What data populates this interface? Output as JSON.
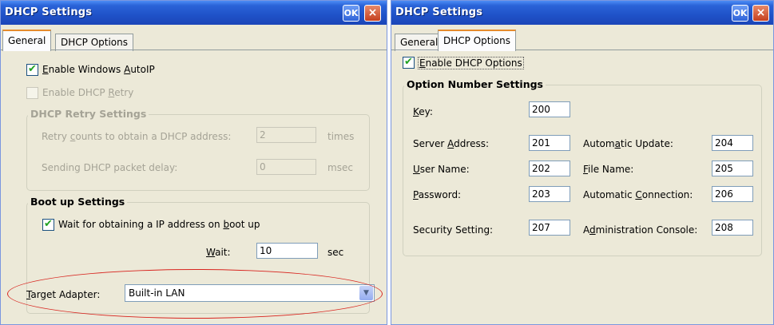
{
  "left_window": {
    "title": "DHCP Settings",
    "ok_label": "OK",
    "close_label": "×",
    "tabs": [
      {
        "label": "General",
        "active": true
      },
      {
        "label": "DHCP Options",
        "active": false
      }
    ],
    "enable_autoip": {
      "prefix": "",
      "accel": "E",
      "rest": "nable Windows ",
      "accel2": "A",
      "rest2": "utoIP",
      "checked": true
    },
    "enable_dhcp_retry": {
      "label_a": "Enable DHCP ",
      "accel": "R",
      "label_b": "etry",
      "checked": false
    },
    "retry_group": {
      "title": "DHCP Retry Settings",
      "retry_counts": {
        "label_a": "Retry ",
        "accel": "c",
        "label_b": "ounts to obtain a DHCP address:",
        "value": "2",
        "unit": "times"
      },
      "packet_delay": {
        "label_a": "Sending DHCP packet delay:",
        "value": "0",
        "unit": "msec"
      }
    },
    "boot_group": {
      "title": "Boot up Settings",
      "wait_ip": {
        "label_a": "Wait for obtaining a IP address on ",
        "accel": "b",
        "label_b": "oot up",
        "checked": true
      },
      "wait": {
        "accel": "W",
        "label_b": "ait:",
        "value": "10",
        "unit": "sec"
      }
    },
    "target_adapter": {
      "accel": "T",
      "label_b": "arget Adapter:",
      "selected": "Built-in LAN"
    }
  },
  "right_window": {
    "title": "DHCP Settings",
    "ok_label": "OK",
    "close_label": "×",
    "tabs": [
      {
        "label": "General",
        "active": false
      },
      {
        "label": "DHCP Options",
        "active": true
      }
    ],
    "enable_options": {
      "accel": "E",
      "label_b": "nable DHCP Options",
      "checked": true
    },
    "option_group": {
      "title": "Option Number Settings",
      "key": {
        "accel": "K",
        "label_b": "ey:",
        "value": "200"
      },
      "server_address": {
        "label_a": "Server ",
        "accel": "A",
        "label_b": "ddress:",
        "value": "201"
      },
      "user_name": {
        "accel": "U",
        "label_b": "ser Name:",
        "value": "202"
      },
      "password": {
        "accel": "P",
        "label_b": "assword:",
        "value": "203"
      },
      "security": {
        "label_a": "Security Setting:",
        "value": "207"
      },
      "auto_update": {
        "label_a": "Autom",
        "accel": "a",
        "label_b": "tic Update:",
        "value": "204"
      },
      "file_name": {
        "accel": "F",
        "label_b": "ile Name:",
        "value": "205"
      },
      "auto_connection": {
        "label_a": "Automatic ",
        "accel": "C",
        "label_b": "onnection:",
        "value": "206"
      },
      "admin_console": {
        "label_a": "A",
        "accel": "d",
        "label_b": "ministration Console:",
        "value": "208"
      }
    }
  },
  "colors": {
    "titlebar": "#2a63d8",
    "window_bg": "#ece9d8",
    "check_green": "#21a121",
    "annotation_red": "#d8251f",
    "tab_active_accent": "#e68b2c"
  }
}
